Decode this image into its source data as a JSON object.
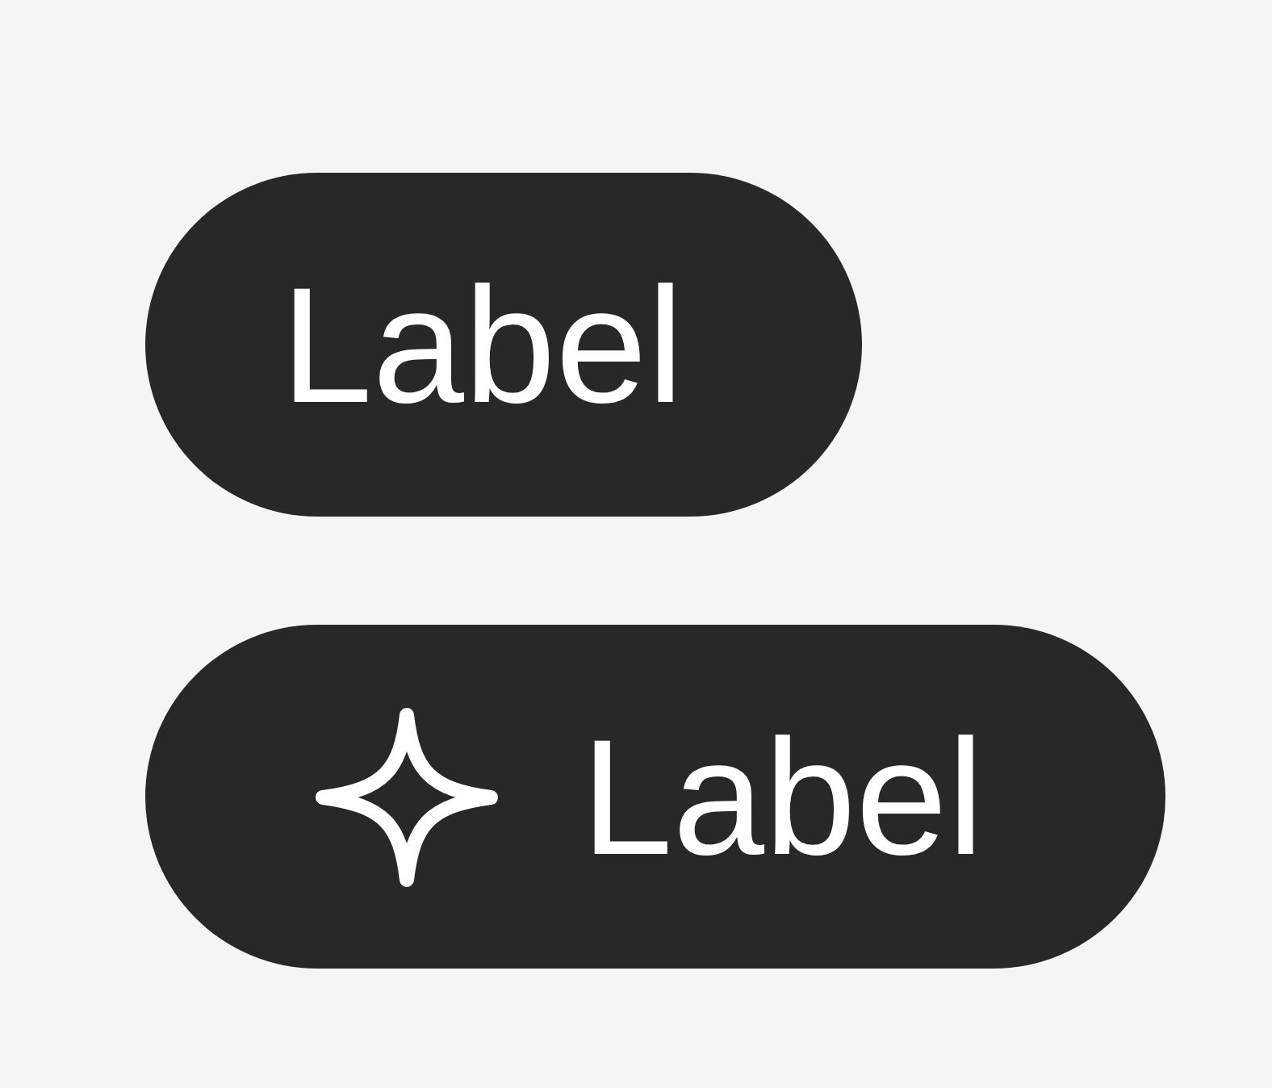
{
  "buttons": [
    {
      "kind": "text",
      "label": "Label"
    },
    {
      "kind": "icon",
      "label": "Label"
    }
  ]
}
